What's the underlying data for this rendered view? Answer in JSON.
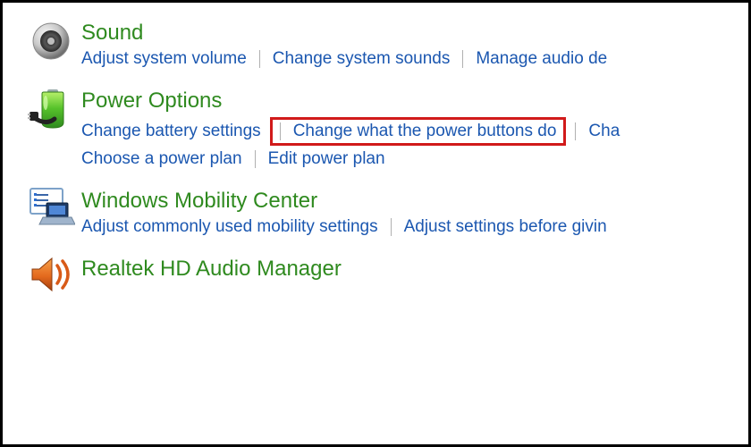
{
  "sections": [
    {
      "title": "Sound",
      "links_row1": [
        "Adjust system volume",
        "Change system sounds",
        "Manage audio de"
      ],
      "links_row2": []
    },
    {
      "title": "Power Options",
      "links_row1": [
        "Change battery settings",
        "Change what the power buttons do",
        "Cha"
      ],
      "links_row2": [
        "Choose a power plan",
        "Edit power plan"
      ]
    },
    {
      "title": "Windows Mobility Center",
      "links_row1": [
        "Adjust commonly used mobility settings",
        "Adjust settings before givin"
      ],
      "links_row2": []
    },
    {
      "title": "Realtek HD Audio Manager",
      "links_row1": [],
      "links_row2": []
    }
  ],
  "highlight": {
    "section": 1,
    "row": 1,
    "index": 1
  }
}
